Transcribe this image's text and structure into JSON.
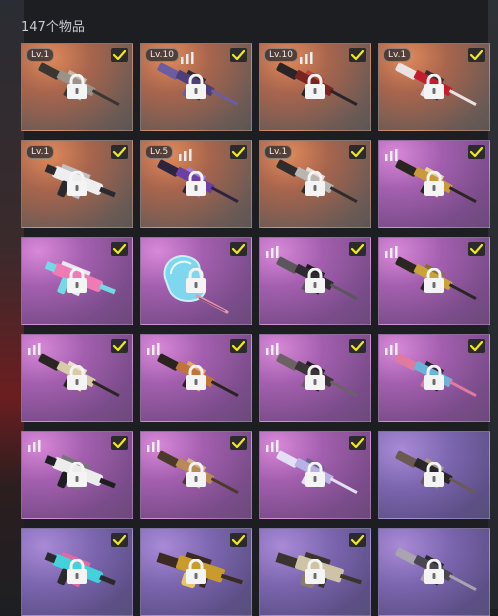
{
  "header": {
    "item_count": "147个物品"
  },
  "items": [
    {
      "bg": "orange",
      "level": "Lv.1",
      "bars": false,
      "checked": true,
      "weapon": "rifle-tan"
    },
    {
      "bg": "orange",
      "level": "Lv.10",
      "bars": true,
      "checked": true,
      "weapon": "rifle-purple"
    },
    {
      "bg": "orange",
      "level": "Lv.10",
      "bars": true,
      "checked": true,
      "weapon": "rifle-red"
    },
    {
      "bg": "orange",
      "level": "Lv.1",
      "bars": false,
      "checked": true,
      "weapon": "rifle-redwhite"
    },
    {
      "bg": "orange",
      "level": "Lv.1",
      "bars": false,
      "checked": true,
      "weapon": "smg-white"
    },
    {
      "bg": "orange",
      "level": "Lv.5",
      "bars": true,
      "checked": true,
      "weapon": "rifle-violet"
    },
    {
      "bg": "orange",
      "level": "Lv.1",
      "bars": false,
      "checked": true,
      "weapon": "rifle-gray"
    },
    {
      "bg": "pink",
      "level": "",
      "bars": true,
      "checked": true,
      "weapon": "rifle-gold"
    },
    {
      "bg": "pink",
      "level": "",
      "bars": false,
      "checked": true,
      "weapon": "smg-pink"
    },
    {
      "bg": "pink",
      "level": "",
      "bars": false,
      "checked": true,
      "weapon": "candy-pickaxe"
    },
    {
      "bg": "pink",
      "level": "",
      "bars": true,
      "checked": true,
      "weapon": "rifle-black"
    },
    {
      "bg": "pink",
      "level": "",
      "bars": true,
      "checked": true,
      "weapon": "rifle-goldblack"
    },
    {
      "bg": "pink",
      "level": "",
      "bars": true,
      "checked": true,
      "weapon": "rifle-cream"
    },
    {
      "bg": "pink",
      "level": "",
      "bars": true,
      "checked": true,
      "weapon": "rifle-orange"
    },
    {
      "bg": "pink",
      "level": "",
      "bars": true,
      "checked": true,
      "weapon": "rifle-black2"
    },
    {
      "bg": "pink",
      "level": "",
      "bars": true,
      "checked": true,
      "weapon": "rifle-blue"
    },
    {
      "bg": "pink",
      "level": "",
      "bars": true,
      "checked": true,
      "weapon": "smg-blackwhite"
    },
    {
      "bg": "pink",
      "level": "",
      "bars": true,
      "checked": true,
      "weapon": "rifle-camo"
    },
    {
      "bg": "pink",
      "level": "",
      "bars": true,
      "checked": true,
      "weapon": "rifle-lilac"
    },
    {
      "bg": "violet",
      "level": "",
      "bars": false,
      "checked": false,
      "weapon": "rifle-darkcamo"
    },
    {
      "bg": "violet",
      "level": "",
      "bars": false,
      "checked": true,
      "weapon": "smg-cyan"
    },
    {
      "bg": "violet",
      "level": "",
      "bars": false,
      "checked": true,
      "weapon": "lmg-gold"
    },
    {
      "bg": "violet",
      "level": "",
      "bars": false,
      "checked": true,
      "weapon": "lmg-khaki"
    },
    {
      "bg": "violet",
      "level": "",
      "bars": false,
      "checked": false,
      "weapon": "rifle-slate"
    }
  ],
  "colors": {
    "orange_tile": "#b0694f",
    "pink_tile": "#a35fae",
    "violet_tile": "#7c66b0",
    "check_mark": "#f2e81a",
    "check_bg": "#2b2b2d"
  }
}
